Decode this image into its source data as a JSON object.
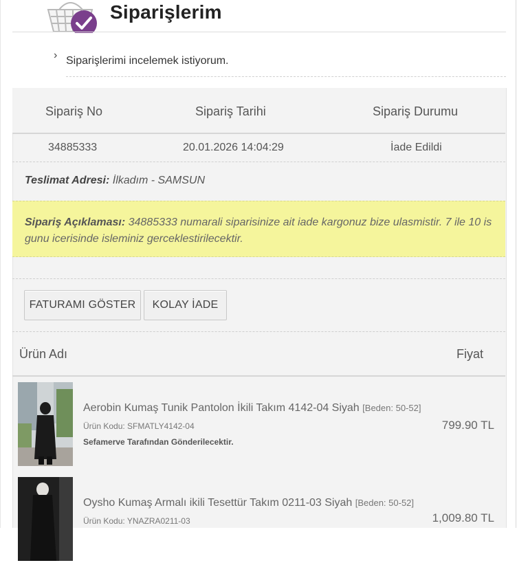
{
  "header": {
    "title": "Siparişlerim"
  },
  "toggle": {
    "chevron": "›",
    "text": "Siparişlerimi incelemek istiyorum."
  },
  "order_table": {
    "headers": [
      "Sipariş No",
      "Sipariş Tarihi",
      "Sipariş Durumu"
    ],
    "values": [
      "34885333",
      "20.01.2026 14:04:29",
      "İade Edildi"
    ]
  },
  "address": {
    "label": "Teslimat Adresi:",
    "value": "İlkadım - SAMSUN"
  },
  "note": {
    "label": "Sipariş Açıklaması:",
    "text": "34885333 numarali siparisinize ait iade kargonuz bize ulasmistir. 7 ile 10 is gunu icerisinde isleminiz gerceklestirilecektir."
  },
  "buttons": {
    "invoice": "FATURAMI GÖSTER",
    "return": "KOLAY İADE"
  },
  "products_table": {
    "header_name": "Ürün Adı",
    "header_price": "Fiyat",
    "items": [
      {
        "name": "Aerobin Kumaş Tunik Pantolon İkili Takım 4142-04 Siyah",
        "size": "[Beden: 50-52]",
        "code": "Ürün Kodu: SFMATLY4142-04",
        "seller": "Sefamerve Tarafından Gönderilecektir.",
        "price": "799.90 TL"
      },
      {
        "name": "Oysho Kumaş Armalı ikili Tesettür Takım 0211-03 Siyah",
        "size": "[Beden: 50-52]",
        "code": "Ürün Kodu: YNAZRA0211-03",
        "seller": "",
        "price": "1,009.80 TL"
      }
    ]
  },
  "colors": {
    "note_bg": "#f5f59c",
    "panel_bg": "#f3f3f3",
    "badge_purple": "#7a3f8c"
  }
}
